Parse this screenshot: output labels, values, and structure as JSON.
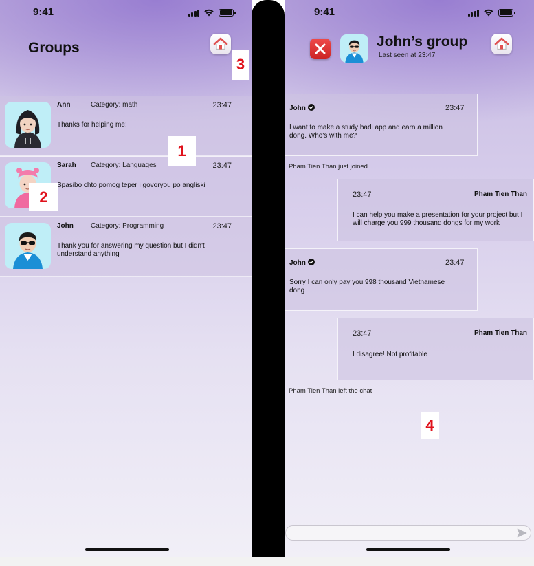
{
  "status_bar": {
    "time": "9:41"
  },
  "groups_screen": {
    "title": "Groups",
    "groups": [
      {
        "name": "Ann",
        "category": "Category: math",
        "time": "23:47",
        "message": "Thanks for helping me!",
        "avatar": "girl-avatar"
      },
      {
        "name": "Sarah",
        "category": "Category: Languages",
        "time": "23:47",
        "message": "Spasibo chto pomog teper i govoryou po angliski",
        "avatar": "pink-hat-avatar"
      },
      {
        "name": "John",
        "category": "Category: Programming",
        "time": "23:47",
        "message": "Thank you for answering my question but I didn't understand anything",
        "avatar": "sunglasses-avatar"
      }
    ]
  },
  "chat_screen": {
    "title": "John’s group",
    "subtitle": "Last seen at 23:47",
    "messages": [
      {
        "sender": "John",
        "time": "23:47",
        "text": "I want to make a study badi app and earn a million dong. Who's with me?"
      },
      {
        "system": "Pham Tien Than just joined"
      },
      {
        "sender": "Pham Tien Than",
        "time": "23:47",
        "text": "I can help you make a presentation for your project but I will charge you 999 thousand dongs for my work"
      },
      {
        "sender": "John",
        "time": "23:47",
        "text": "Sorry I can only pay you 998 thousand Vietnamese dong"
      },
      {
        "sender": "Pham Tien Than",
        "time": "23:47",
        "text": "I disagree! Not profitable"
      },
      {
        "system": "Pham Tien Than left the chat"
      }
    ],
    "input": {
      "value": "",
      "placeholder": ""
    }
  },
  "markers": [
    "1",
    "2",
    "3",
    "4"
  ],
  "colors": {
    "close_button": "#dd3333",
    "marker_text": "#e0121c",
    "avatar_bg": "#bfeef7",
    "home_icon": "#e05050"
  },
  "icons": [
    "signal-icon",
    "wifi-icon",
    "battery-icon",
    "home-icon",
    "close-icon",
    "verified-icon",
    "send-icon"
  ]
}
